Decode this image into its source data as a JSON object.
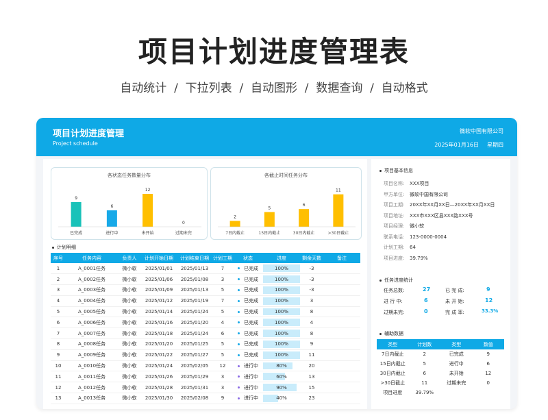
{
  "hero": {
    "title": "项目计划进度管理表",
    "subtitle": "自动统计  /  下拉列表  /  自动图形  /  数据查询  /  自动格式"
  },
  "header": {
    "title": "项目计划进度管理",
    "subtitle": "Project schedule",
    "company": "微软中国有限公司",
    "date": "2025年01月16日",
    "weekday": "星期四"
  },
  "colors": {
    "accent": "#0fa9e6",
    "teal": "#19c2b9",
    "blue": "#17a9e8",
    "yellow": "#ffbf00",
    "purple": "#8b6ce6"
  },
  "chart_data": [
    {
      "type": "bar",
      "title": "各状态任务数量分布",
      "categories": [
        "已完成",
        "进行中",
        "未开始",
        "过期未完"
      ],
      "values": [
        9,
        6,
        12,
        0
      ],
      "colors": [
        "#19c2b9",
        "#17a9e8",
        "#ffbf00",
        "#ffbf00"
      ],
      "ylim": [
        0,
        14
      ],
      "grid": false
    },
    {
      "type": "bar",
      "title": "各截止时间任务分布",
      "categories": [
        "7日内截止",
        "15日内截止",
        "30日内截止",
        ">30日截止"
      ],
      "values": [
        2,
        5,
        6,
        11
      ],
      "colors": [
        "#ffbf00",
        "#ffbf00",
        "#ffbf00",
        "#ffbf00"
      ],
      "ylim": [
        0,
        13
      ],
      "grid": false
    }
  ],
  "plan": {
    "label": "计划明细",
    "columns": [
      "序号",
      "任务内容",
      "负责人",
      "计划开始日期",
      "计划结束日期",
      "计划工期",
      "状态",
      "进度",
      "剩余天数",
      "备注"
    ],
    "rows": [
      [
        "1",
        "A_0001任务",
        "微小软",
        "2025/01/01",
        "2025/01/13",
        "7",
        "已完成",
        "100%",
        "-3",
        ""
      ],
      [
        "2",
        "A_0002任务",
        "微小软",
        "2025/01/06",
        "2025/01/08",
        "3",
        "已完成",
        "100%",
        "-3",
        ""
      ],
      [
        "3",
        "A_0003任务",
        "微小软",
        "2025/01/09",
        "2025/01/13",
        "5",
        "已完成",
        "100%",
        "-3",
        ""
      ],
      [
        "4",
        "A_0004任务",
        "微小软",
        "2025/01/12",
        "2025/01/19",
        "7",
        "已完成",
        "100%",
        "3",
        ""
      ],
      [
        "5",
        "A_0005任务",
        "微小软",
        "2025/01/14",
        "2025/01/24",
        "5",
        "已完成",
        "100%",
        "8",
        ""
      ],
      [
        "6",
        "A_0006任务",
        "微小软",
        "2025/01/16",
        "2025/01/20",
        "4",
        "已完成",
        "100%",
        "4",
        ""
      ],
      [
        "7",
        "A_0007任务",
        "微小软",
        "2025/01/18",
        "2025/01/24",
        "6",
        "已完成",
        "100%",
        "8",
        ""
      ],
      [
        "8",
        "A_0008任务",
        "微小软",
        "2025/01/20",
        "2025/01/25",
        "5",
        "已完成",
        "100%",
        "9",
        ""
      ],
      [
        "9",
        "A_0009任务",
        "微小软",
        "2025/01/22",
        "2025/01/27",
        "5",
        "已完成",
        "100%",
        "11",
        ""
      ],
      [
        "10",
        "A_0010任务",
        "微小软",
        "2025/01/24",
        "2025/02/05",
        "12",
        "进行中",
        "80%",
        "20",
        ""
      ],
      [
        "11",
        "A_0011任务",
        "微小软",
        "2025/01/26",
        "2025/01/29",
        "3",
        "进行中",
        "60%",
        "13",
        ""
      ],
      [
        "12",
        "A_0012任务",
        "微小软",
        "2025/01/28",
        "2025/01/31",
        "3",
        "进行中",
        "90%",
        "15",
        ""
      ],
      [
        "13",
        "A_0013任务",
        "微小软",
        "2025/01/30",
        "2025/02/08",
        "9",
        "进行中",
        "40%",
        "23",
        ""
      ]
    ],
    "progress_values": [
      1,
      1,
      1,
      1,
      1,
      1,
      1,
      1,
      1,
      0.8,
      0.6,
      0.9,
      0.4
    ]
  },
  "info": {
    "label": "项目基本信息",
    "items": [
      {
        "k": "项目名称:",
        "v": "XXX项目"
      },
      {
        "k": "甲方单位:",
        "v": "微软中国有限公司"
      },
      {
        "k": "项目工期:",
        "v": "20XX年XX月XX日—20XX年XX月XX日"
      },
      {
        "k": "项目地址:",
        "v": "XXX市XXX区县XXX路XXX号"
      },
      {
        "k": "项目经理:",
        "v": "微小软"
      },
      {
        "k": "联系电话:",
        "v": "123-0000-0004"
      },
      {
        "k": "计划工期:",
        "v": "64"
      },
      {
        "k": "项目进度:",
        "v": "39.79%"
      }
    ]
  },
  "stats": {
    "label": "任务进度统计",
    "total_k": "任务总数:",
    "total_v": "27",
    "done_k": "已 完 成:",
    "done_v": "9",
    "doing_k": "进 行 中:",
    "doing_v": "6",
    "todo_k": "未 开 始:",
    "todo_v": "12",
    "overdue_k": "过期未完:",
    "overdue_v": "0",
    "rate_k": "完 成 率:",
    "rate_v": "33.3%"
  },
  "aux": {
    "label": "辅助数据",
    "columns": [
      "类型",
      "计划数",
      "类型",
      "数值"
    ],
    "rows": [
      [
        "7日内截止",
        "2",
        "已完成",
        "9"
      ],
      [
        "15日内截止",
        "5",
        "进行中",
        "6"
      ],
      [
        "30日内截止",
        "6",
        "未开始",
        "12"
      ],
      [
        ">30日截止",
        "11",
        "过期未完",
        "0"
      ]
    ],
    "footer_k": "项目进度",
    "footer_v": "39.79%"
  }
}
